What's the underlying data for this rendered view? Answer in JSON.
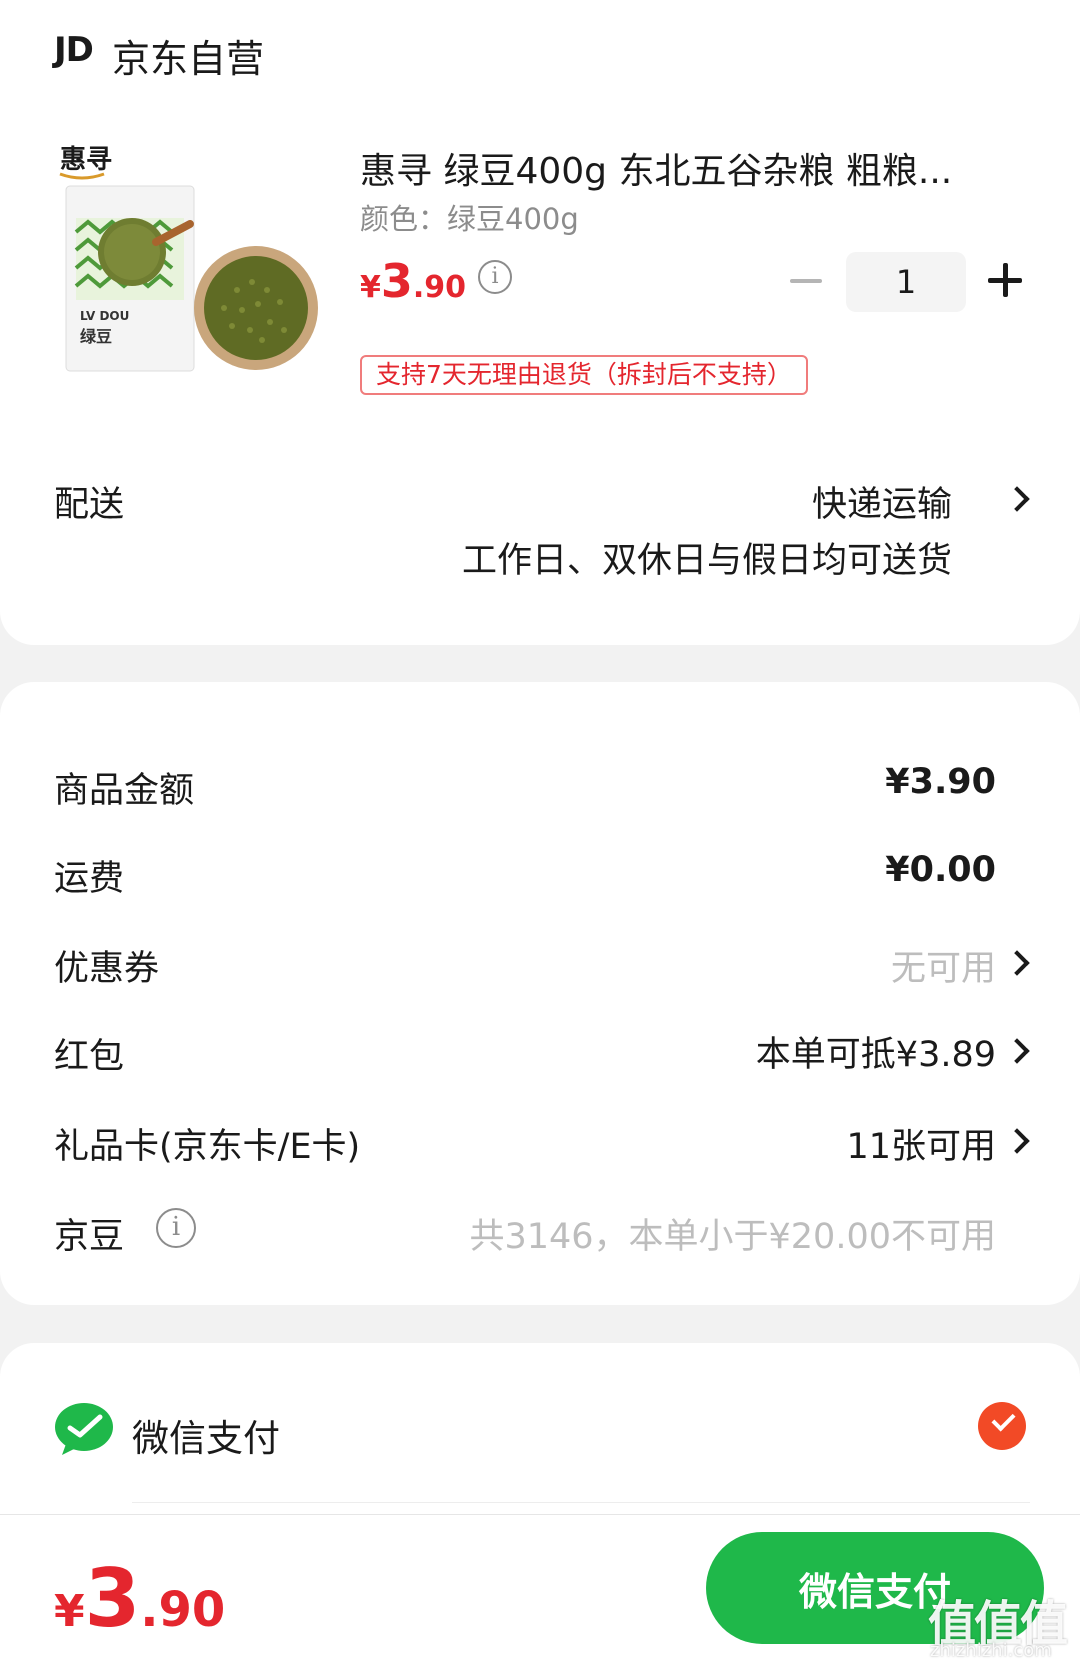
{
  "store": {
    "logo": "JD",
    "name": "京东自营"
  },
  "product": {
    "brand_logo": "惠寻",
    "package_text": "LV DOU",
    "package_name": "绿豆",
    "title": "惠寻 绿豆400g 东北五谷杂粮 粗粮...",
    "variant": "颜色：绿豆400g",
    "price_currency": "¥",
    "price_int": "3",
    "price_dec": ".90",
    "quantity": "1",
    "return_policy": "支持7天无理由退货（拆封后不支持）"
  },
  "delivery": {
    "label": "配送",
    "method": "快递运输",
    "note": "工作日、双休日与假日均可送货"
  },
  "summary": {
    "goods_amount_label": "商品金额",
    "goods_amount_value": "¥3.90",
    "shipping_label": "运费",
    "shipping_value": "¥0.00",
    "coupon_label": "优惠券",
    "coupon_value": "无可用",
    "redpacket_label": "红包",
    "redpacket_value": "本单可抵¥3.89",
    "giftcard_label": "礼品卡(京东卡/E卡)",
    "giftcard_value": "11张可用",
    "jingdou_label": "京豆",
    "jingdou_value": "共3146，本单小于¥20.00不可用"
  },
  "payment": {
    "method": "微信支付",
    "selected": true
  },
  "bottom": {
    "total_currency": "¥",
    "total_int": "3",
    "total_dec": ".90",
    "pay_button": "微信支付",
    "watermark": "值值值",
    "watermark_sub": "zhizhizhi.com"
  },
  "colors": {
    "price_red": "#e4262e",
    "wechat_green": "#1fb84a",
    "check_orange": "#f24a26"
  }
}
